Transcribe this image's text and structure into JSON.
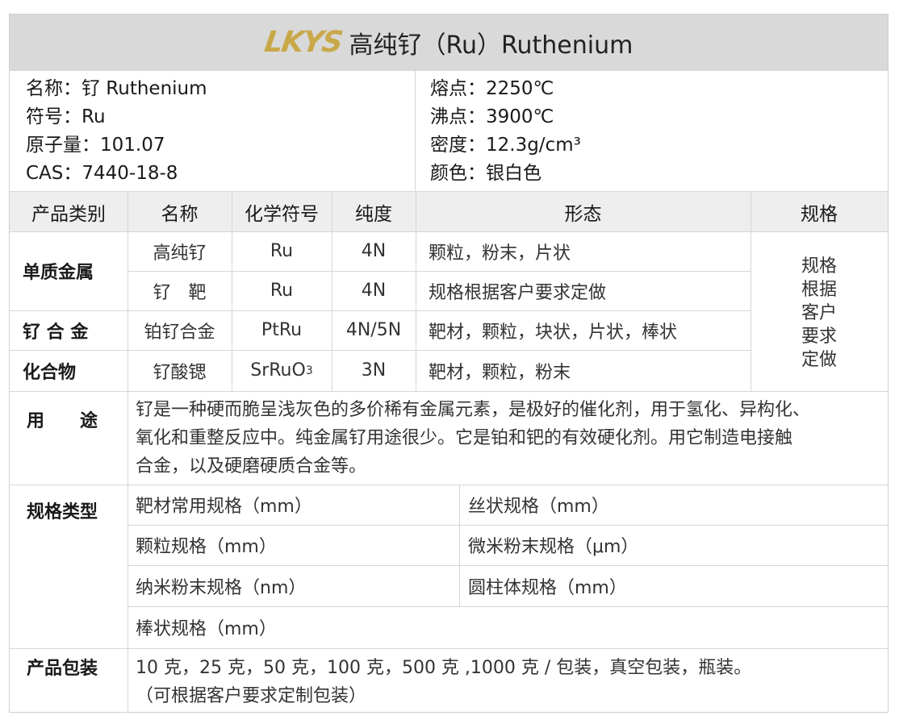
{
  "header": {
    "logo": "LKYS",
    "title": "高纯钌（Ru）Ruthenium"
  },
  "info_left": [
    "名称：钌 Ruthenium",
    "符号：Ru",
    "原子量：101.07",
    "CAS：7440-18-8"
  ],
  "info_right": [
    "熔点：2250℃",
    "沸点：3900℃",
    "密度：12.3g/cm³",
    "颜色：银白色"
  ],
  "table_headers": [
    "产品类别",
    "名称",
    "化学符号",
    "纯度",
    "形态",
    "规格"
  ],
  "categories": {
    "single_metal": "单质金属",
    "alloy": "钌 合 金",
    "compound": "化合物"
  },
  "rows": [
    {
      "name": "高纯钌",
      "symbol": "Ru",
      "purity": "4N",
      "form": "颗粒，粉末，片状"
    },
    {
      "name": "钌　靶",
      "symbol": "Ru",
      "purity": "4N",
      "form": "规格根据客户要求定做"
    },
    {
      "name": "铂钌合金",
      "symbol": "PtRu",
      "purity": "4N/5N",
      "form": "靶材，颗粒，块状，片状，棒状"
    },
    {
      "name": "钌酸锶",
      "symbol_main": "SrRuO",
      "symbol_sub": "3",
      "purity": "3N",
      "form": "靶材，颗粒，粉末"
    }
  ],
  "spec_note": [
    "规格",
    "根据",
    "客户",
    "要求",
    "定做"
  ],
  "usage": {
    "label": "用　　途",
    "lines": [
      "钌是一种硬而脆呈浅灰色的多价稀有金属元素，是极好的催化剂，用于氢化、异构化、",
      "氧化和重整反应中。纯金属钌用途很少。它是铂和钯的有效硬化剂。用它制造电接触",
      "合金，以及硬磨硬质合金等。"
    ]
  },
  "spec_types": {
    "label": "规格类型",
    "items": [
      "靶材常用规格（mm）",
      "丝状规格（mm）",
      "颗粒规格（mm）",
      "微米粉末规格（μm）",
      "纳米粉末规格（nm）",
      "圆柱体规格（mm）",
      "棒状规格（mm）"
    ]
  },
  "packaging": {
    "label": "产品包装",
    "lines": [
      "10 克，25 克，50 克，100 克，500 克 ,1000 克 / 包装，真空包装，瓶装。",
      "（可根据客户要求定制包装）"
    ]
  }
}
